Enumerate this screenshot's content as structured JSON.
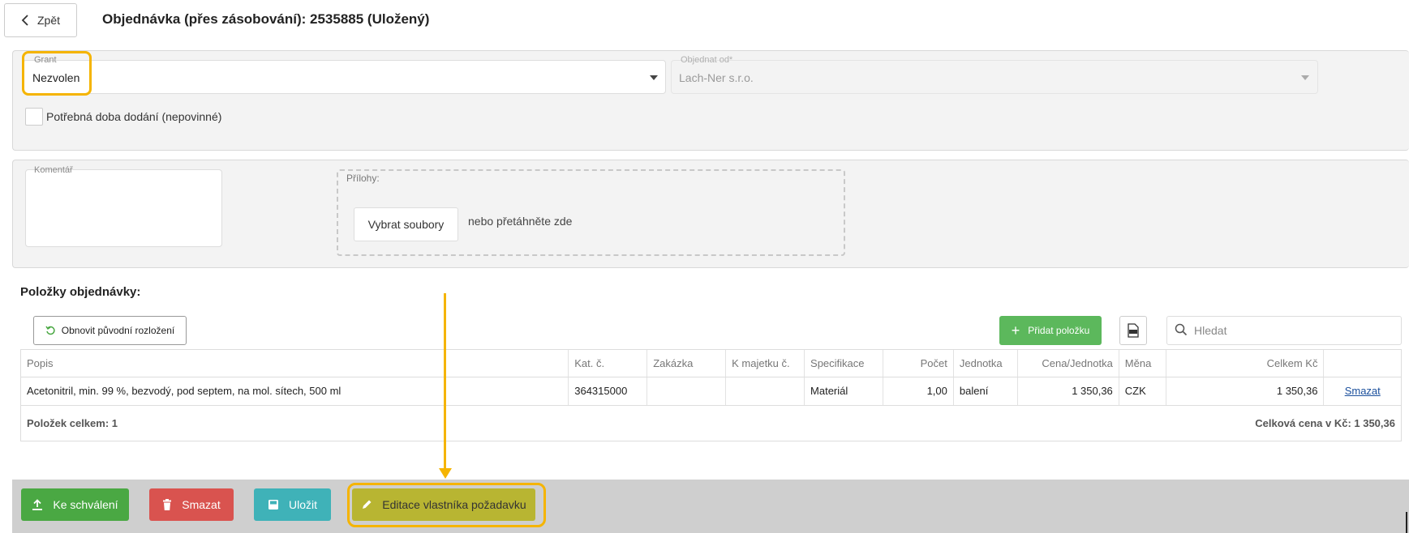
{
  "header": {
    "back_label": "Zpět",
    "title": "Objednávka (přes zásobování): 2535885 (Uložený)"
  },
  "form": {
    "grant": {
      "label": "Grant",
      "value": "Nezvolen"
    },
    "order_from": {
      "label": "Objednat od*",
      "value": "Lach-Ner s.r.o."
    },
    "delivery_checkbox_label": "Potřebná doba dodání (nepovinné)",
    "delivery_checked": false,
    "comment_label": "Komentář",
    "attachments_label": "Přílohy:",
    "select_files_label": "Vybrat soubory",
    "drop_text": "nebo přetáhněte zde"
  },
  "items": {
    "section_title": "Položky objednávky:",
    "reset_layout_label": "Obnovit původní rozložení",
    "add_item_label": "Přidat položku",
    "search_placeholder": "Hledat",
    "columns": [
      "Popis",
      "Kat. č.",
      "Zakázka",
      "K majetku č.",
      "Specifikace",
      "Počet",
      "Jednotka",
      "Cena/Jednotka",
      "Měna",
      "Celkem Kč",
      ""
    ],
    "rows": [
      {
        "popis": "Acetonitril, min. 99 %, bezvodý, pod septem, na mol. sítech, 500 ml",
        "kat": "364315000",
        "zakazka": "",
        "majetek": "",
        "specifikace": "Materiál",
        "pocet": "1,00",
        "jednotka": "balení",
        "cena": "1 350,36",
        "mena": "CZK",
        "celkem": "1 350,36",
        "action": "Smazat"
      }
    ],
    "total_count": "Položek celkem: 1",
    "total_price": "Celková cena v Kč: 1 350,36"
  },
  "actions": {
    "approve": "Ke schválení",
    "delete": "Smazat",
    "save": "Uložit",
    "edit_owner": "Editace vlastníka požadavku"
  },
  "colors": {
    "highlight": "#f5b400",
    "approve": "#4aa843",
    "delete": "#d9534f",
    "save": "#3fb2b8",
    "edit_owner": "#b8b532",
    "add": "#5cb85c"
  }
}
